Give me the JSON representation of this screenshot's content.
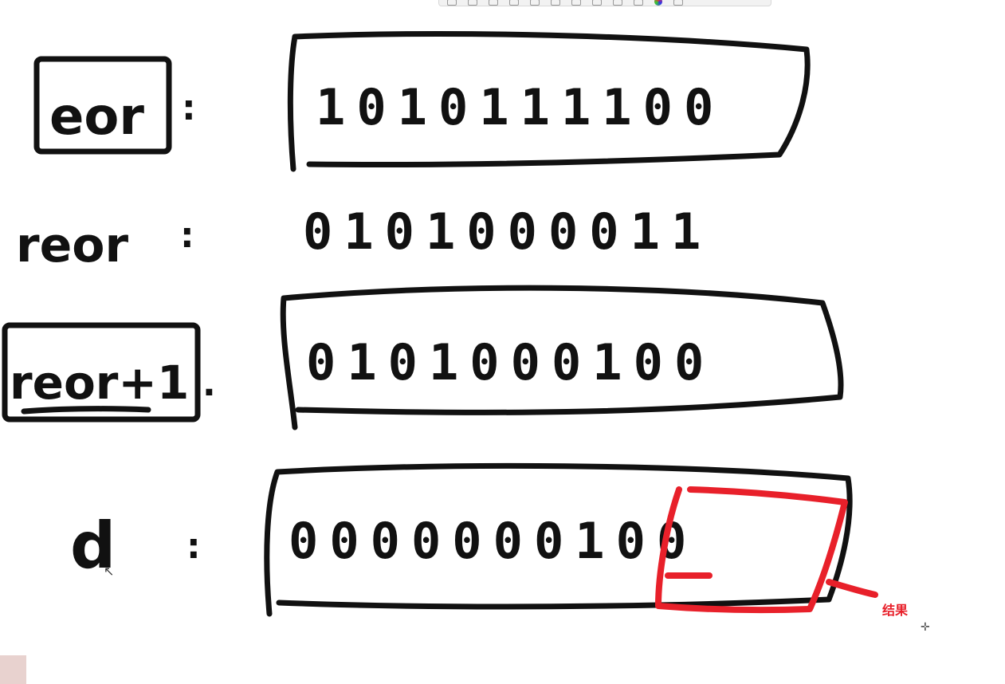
{
  "toolbar": {
    "icons": [
      "cursor-icon",
      "zoom-icon",
      "pin-icon",
      "text-icon",
      "rectangle-icon",
      "shape-icon",
      "circle-icon",
      "code-icon",
      "page-icon",
      "image-icon",
      "color-wheel-icon",
      "grid-icon"
    ]
  },
  "rows": [
    {
      "label": "eor",
      "colon": ":",
      "bits": "1010111100",
      "boxed": true
    },
    {
      "label": "reor",
      "colon": ":",
      "bits": "0101000011",
      "boxed": false
    },
    {
      "label": "reor+1",
      "colon": ".",
      "bits": "0101000100",
      "boxed": true
    },
    {
      "label": "d",
      "colon": ":",
      "bits": "0000000100",
      "boxed": true
    }
  ],
  "annotation": {
    "text": "结果",
    "color": "#e8202a"
  },
  "ink_color": "#111111"
}
